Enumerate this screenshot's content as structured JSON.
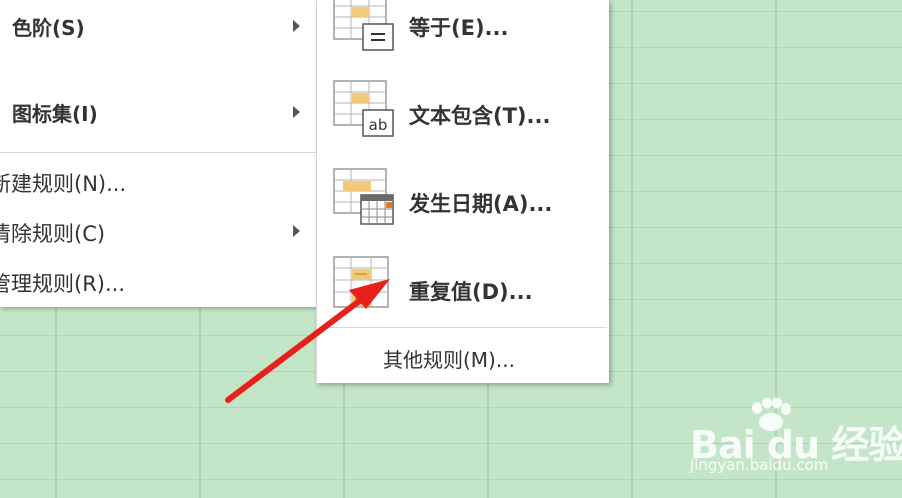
{
  "menu": {
    "items": [
      {
        "label": "色阶(S)",
        "has_submenu": true
      },
      {
        "label": "图标集(I)",
        "has_submenu": true
      },
      {
        "label": "新建规则(N)...",
        "has_submenu": false
      },
      {
        "label": "清除规则(C)",
        "has_submenu": true
      },
      {
        "label": "管理规则(R)...",
        "has_submenu": false
      }
    ]
  },
  "submenu": {
    "items": [
      {
        "label": "等于(E)...",
        "icon": "equal-to-icon"
      },
      {
        "label": "文本包含(T)...",
        "icon": "text-contains-icon"
      },
      {
        "label": "发生日期(A)...",
        "icon": "date-occurring-icon"
      },
      {
        "label": "重复值(D)...",
        "icon": "duplicate-values-icon"
      }
    ],
    "other_rules": "其他规则(M)..."
  },
  "icon_text": {
    "ab": "ab"
  },
  "watermark": {
    "brand": "Bai du 经验",
    "url": "jingyan.baidu.com"
  },
  "colors": {
    "sheet_background": "#c4e6c8",
    "gridline": "#b3d3b7",
    "highlight_bar": "#f5c97a",
    "annotation_arrow": "#e8201a"
  }
}
